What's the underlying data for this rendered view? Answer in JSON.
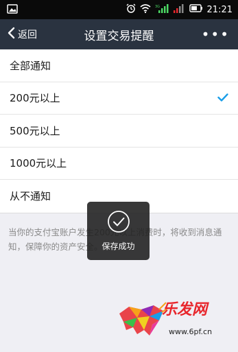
{
  "status_bar": {
    "time": "21:21",
    "icons": [
      "image-icon",
      "alarm-icon",
      "wifi-icon",
      "signal-icon",
      "signal-icon",
      "battery-icon"
    ]
  },
  "nav": {
    "back_label": "返回",
    "title": "设置交易提醒",
    "more_label": "•••"
  },
  "options": [
    {
      "label": "全部通知",
      "selected": false
    },
    {
      "label": "200元以上",
      "selected": true
    },
    {
      "label": "500元以上",
      "selected": false
    },
    {
      "label": "1000元以上",
      "selected": false
    },
    {
      "label": "从不通知",
      "selected": false
    }
  ],
  "note": "当你的支付宝账户发生200元以上消费时，将收到消息通知，保障你的资产安全。",
  "toast": {
    "label": "保存成功"
  },
  "watermark": {
    "brand": "乐发网",
    "url": "www.6pf.cn"
  },
  "colors": {
    "nav_bg": "#2a3340",
    "check": "#1a9ee8",
    "status_bg": "#0a0a0a",
    "signal_green": "#4cd964",
    "signal_red": "#e8262c"
  }
}
